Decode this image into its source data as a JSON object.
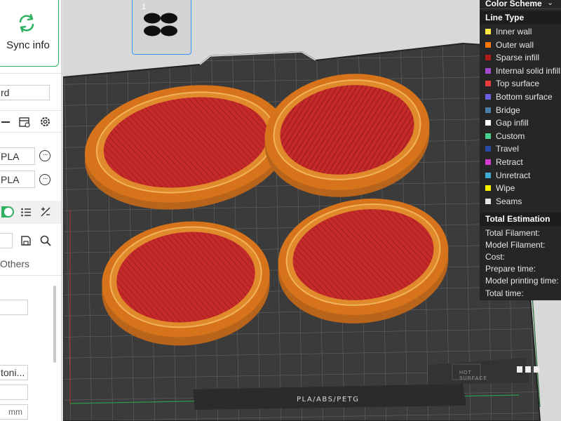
{
  "left_panel": {
    "sync_label": "Sync info",
    "field_name": "rd",
    "filament_1": "PLA",
    "filament_2": "PLA",
    "others_label": "Others",
    "material_field": "toni...",
    "unit_label": "mm"
  },
  "viewport": {
    "plate_number": "1",
    "plate_label": "PLA/ABS/PETG",
    "notice_text": "HOT\nSURFACE"
  },
  "legend": {
    "scheme_title": "Color Scheme",
    "line_type_title": "Line Type",
    "items": [
      {
        "label": "Inner wall",
        "color": "#ffe74a"
      },
      {
        "label": "Outer wall",
        "color": "#ff7b00"
      },
      {
        "label": "Sparse infill",
        "color": "#b11b1b"
      },
      {
        "label": "Internal solid infill",
        "color": "#a24bd2"
      },
      {
        "label": "Top surface",
        "color": "#f03c3c"
      },
      {
        "label": "Bottom surface",
        "color": "#6a63e0"
      },
      {
        "label": "Bridge",
        "color": "#4d7ea8"
      },
      {
        "label": "Gap infill",
        "color": "#ffffff"
      },
      {
        "label": "Custom",
        "color": "#4dd08f"
      },
      {
        "label": "Travel",
        "color": "#2b4aa8"
      },
      {
        "label": "Retract",
        "color": "#d63fd6"
      },
      {
        "label": "Unretract",
        "color": "#3fa9d6"
      },
      {
        "label": "Wipe",
        "color": "#fff200"
      },
      {
        "label": "Seams",
        "color": "#e6e6e6"
      }
    ],
    "estimation_title": "Total Estimation",
    "estimation": [
      "Total Filament:",
      "Model Filament:",
      "Cost:",
      "Prepare time:",
      "Model printing time:",
      "Total time:"
    ]
  },
  "colors": {
    "accent": "#2fb062",
    "selection": "#3a95ff",
    "infill": "#c42a2a",
    "wall": "#d7731a",
    "plate": "#3c3c3c"
  }
}
